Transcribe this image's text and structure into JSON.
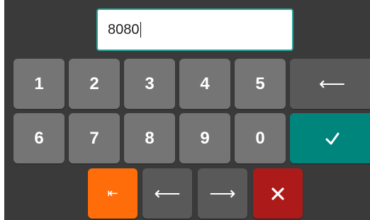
{
  "input": {
    "value": "8080"
  },
  "keys": {
    "row1": [
      "1",
      "2",
      "3",
      "4",
      "5"
    ],
    "row2": [
      "6",
      "7",
      "8",
      "9",
      "0"
    ],
    "backspace_glyph": "⟵",
    "move_left_glyph": "⟵",
    "move_right_glyph": "⟶",
    "home_glyph": "⇤"
  },
  "icons": {
    "backspace": "backspace-arrow-icon",
    "accept": "checkmark-icon",
    "home": "move-to-start-icon",
    "move_left": "arrow-left-icon",
    "move_right": "arrow-right-icon",
    "cancel": "close-x-icon"
  },
  "colors": {
    "background": "#3a3a3a",
    "digit_key": "#757575",
    "function_key": "#595959",
    "accept_key": "#00857d",
    "cancel_key": "#ad1a1a",
    "home_key": "#ff6d0a",
    "input_border": "#26a69a"
  }
}
